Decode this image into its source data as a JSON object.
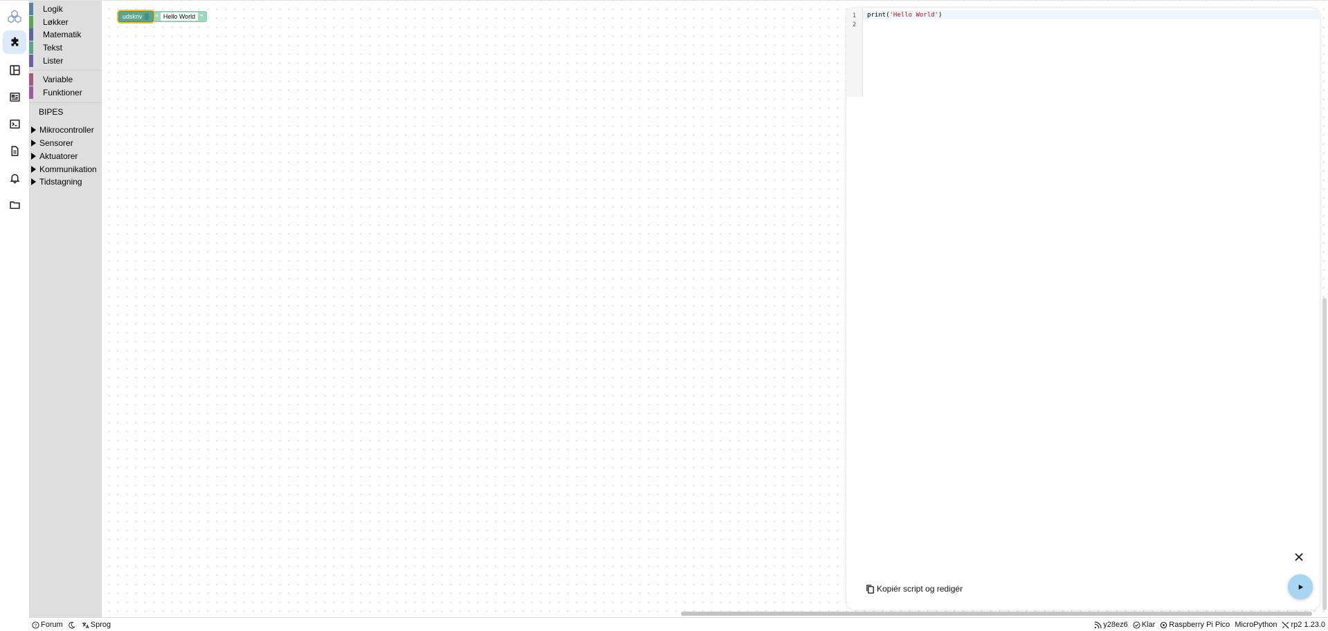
{
  "toolbox": {
    "categories": [
      {
        "label": "Logik",
        "color": "#5b80a5"
      },
      {
        "label": "Løkker",
        "color": "#5ba55b"
      },
      {
        "label": "Matematik",
        "color": "#5b67a5"
      },
      {
        "label": "Tekst",
        "color": "#5ba58c"
      },
      {
        "label": "Lister",
        "color": "#745ba5"
      }
    ],
    "categories2": [
      {
        "label": "Variable",
        "color": "#a55b80"
      },
      {
        "label": "Funktioner",
        "color": "#995ba5"
      }
    ],
    "section_title": "BIPES",
    "tree_items": [
      "Mikrocontroller",
      "Sensorer",
      "Aktuatorer",
      "Kommunikation",
      "Tidstagning"
    ]
  },
  "workspace": {
    "print_block_label": "udskriv",
    "text_block_value": "Hello World",
    "quote_open": "❝",
    "quote_close": "❞"
  },
  "code_panel": {
    "line_numbers": [
      "1",
      "2"
    ],
    "code_prefix": "print(",
    "code_string": "'Hello World'",
    "code_suffix": ")",
    "copy_label": "Kopiér script og redigér"
  },
  "statusbar": {
    "forum_label": "Forum",
    "language_label": "Sprog",
    "device_id": "y28ez6",
    "status": "Klar",
    "board": "Raspberry Pi Pico",
    "firmware": "MicroPython",
    "version": "rp2 1.23.0"
  },
  "colors": {
    "accent": "#a7d6f2",
    "rail_active": "#dbeaf6",
    "text_block": "#5ba58c"
  },
  "icons": {
    "rail": [
      "bipes-logo-icon",
      "puzzle-icon",
      "layout-icon",
      "dashboard-icon",
      "terminal-icon",
      "document-icon",
      "bell-icon",
      "folder-icon"
    ]
  }
}
